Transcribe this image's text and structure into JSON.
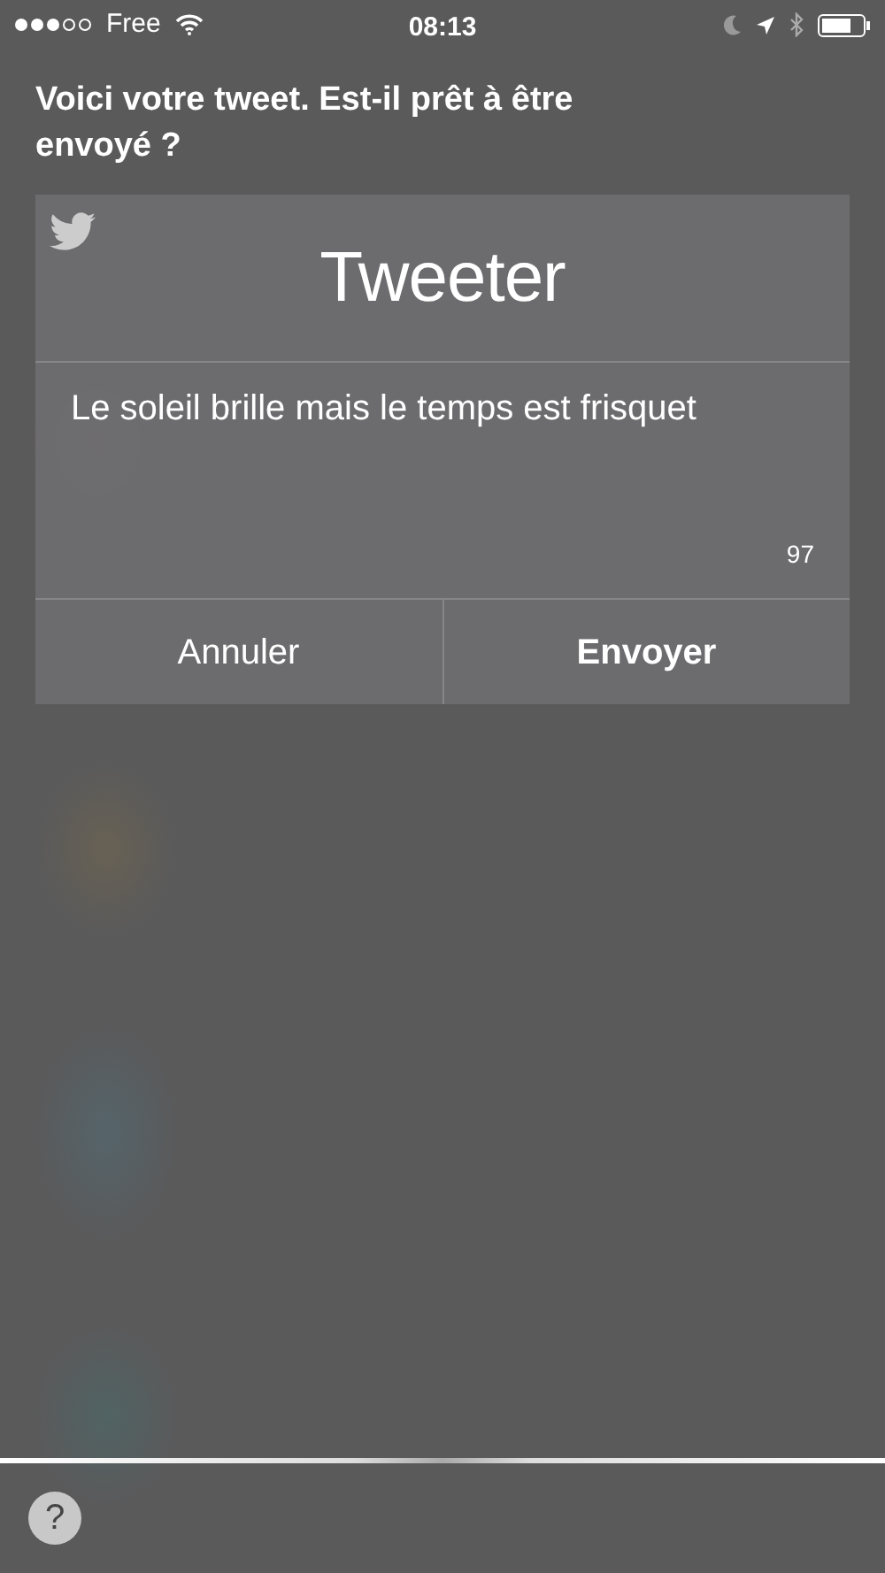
{
  "status_bar": {
    "carrier": "Free",
    "time": "08:13"
  },
  "prompt": "Voici votre tweet. Est-il prêt à être envoyé ?",
  "card": {
    "title": "Tweeter",
    "message": "Le soleil brille mais le temps est frisquet",
    "counter": "97",
    "buttons": [
      {
        "label": "Annuler",
        "kind": "cancel"
      },
      {
        "label": "Envoyer",
        "kind": "confirm"
      }
    ]
  },
  "help": "?"
}
